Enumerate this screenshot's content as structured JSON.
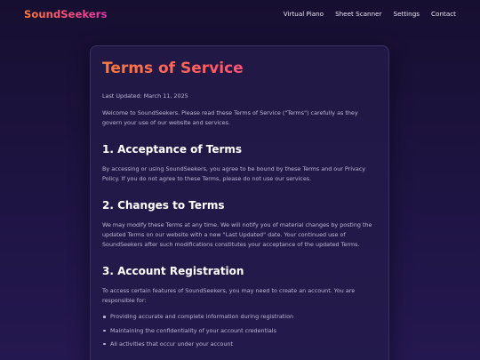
{
  "nav": {
    "brand": "SoundSeekers",
    "links": [
      "Virtual Piano",
      "Sheet Scanner",
      "Settings",
      "Contact"
    ]
  },
  "page": {
    "title": "Terms of Service",
    "last_updated": "Last Updated: March 11, 2025",
    "intro": "Welcome to SoundSeekers. Please read these Terms of Service (\"Terms\") carefully as they govern your use of our website and services.",
    "sections": [
      {
        "heading": "1. Acceptance of Terms",
        "body": "By accessing or using SoundSeekers, you agree to be bound by these Terms and our Privacy Policy. If you do not agree to these Terms, please do not use our services."
      },
      {
        "heading": "2. Changes to Terms",
        "body": "We may modify these Terms at any time. We will notify you of material changes by posting the updated Terms on our website with a new \"Last Updated\" date. Your continued use of SoundSeekers after such modifications constitutes your acceptance of the updated Terms."
      },
      {
        "heading": "3. Account Registration",
        "body": "To access certain features of SoundSeekers, you may need to create an account. You are responsible for:",
        "bullets": [
          "Providing accurate and complete information during registration",
          "Maintaining the confidentiality of your account credentials",
          "All activities that occur under your account"
        ]
      }
    ]
  },
  "colors": {
    "background": "#1a1238",
    "card": "#221845",
    "accent_start": "#ff7a3a",
    "accent_mid": "#ff4d7e",
    "accent_end": "#e13aa8",
    "heading": "#ffffff",
    "body_text": "#bdb6d4"
  }
}
